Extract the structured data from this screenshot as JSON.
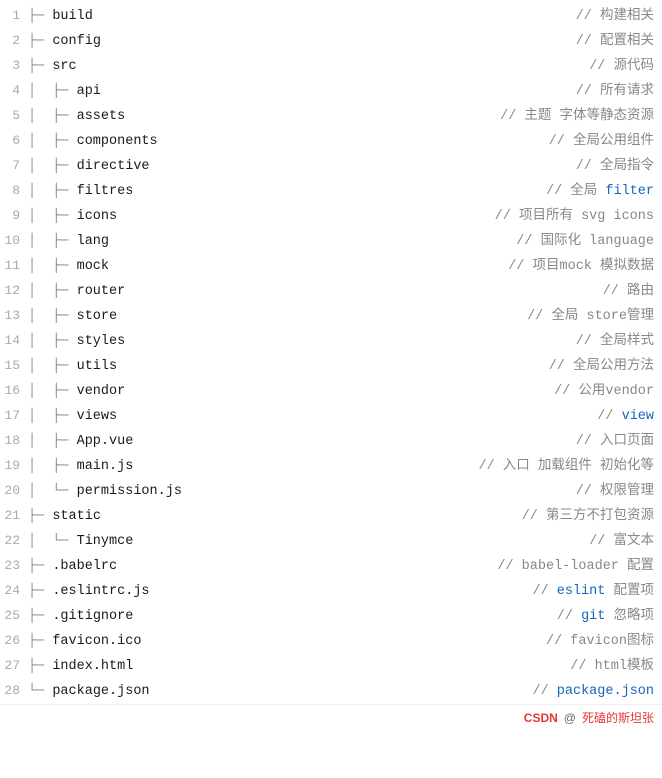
{
  "lines": [
    {
      "num": 1,
      "indent": "├─ ",
      "level": 0,
      "name": "build",
      "comment": "// 构建相关",
      "commentHighlight": null
    },
    {
      "num": 2,
      "indent": "├─ ",
      "level": 0,
      "name": "config",
      "comment": "// 配置相关",
      "commentHighlight": null
    },
    {
      "num": 3,
      "indent": "├─ ",
      "level": 0,
      "name": "src",
      "comment": "// 源代码",
      "commentHighlight": null
    },
    {
      "num": 4,
      "indent": "│  ├─ ",
      "level": 1,
      "name": "api",
      "comment": "// 所有请求",
      "commentHighlight": null
    },
    {
      "num": 5,
      "indent": "│  ├─ ",
      "level": 1,
      "name": "assets",
      "comment": "// 主题 字体等静态资源",
      "commentHighlight": null
    },
    {
      "num": 6,
      "indent": "│  ├─ ",
      "level": 1,
      "name": "components",
      "comment": "// 全局公用组件",
      "commentHighlight": null
    },
    {
      "num": 7,
      "indent": "│  ├─ ",
      "level": 1,
      "name": "directive",
      "comment": "// 全局指令",
      "commentHighlight": null
    },
    {
      "num": 8,
      "indent": "│  ├─ ",
      "level": 1,
      "name": "filtres",
      "comment": "// 全局 filter",
      "commentHighlight": "filter"
    },
    {
      "num": 9,
      "indent": "│  ├─ ",
      "level": 1,
      "name": "icons",
      "comment": "// 项目所有 svg icons",
      "commentHighlight": null
    },
    {
      "num": 10,
      "indent": "│  ├─ ",
      "level": 1,
      "name": "lang",
      "comment": "// 国际化 language",
      "commentHighlight": null
    },
    {
      "num": 11,
      "indent": "│  ├─ ",
      "level": 1,
      "name": "mock",
      "comment": "// 项目mock 模拟数据",
      "commentHighlight": null
    },
    {
      "num": 12,
      "indent": "│  ├─ ",
      "level": 1,
      "name": "router",
      "comment": "// 路由",
      "commentHighlight": null
    },
    {
      "num": 13,
      "indent": "│  ├─ ",
      "level": 1,
      "name": "store",
      "comment": "// 全局 store管理",
      "commentHighlight": null
    },
    {
      "num": 14,
      "indent": "│  ├─ ",
      "level": 1,
      "name": "styles",
      "comment": "// 全局样式",
      "commentHighlight": null
    },
    {
      "num": 15,
      "indent": "│  ├─ ",
      "level": 1,
      "name": "utils",
      "comment": "// 全局公用方法",
      "commentHighlight": null
    },
    {
      "num": 16,
      "indent": "│  ├─ ",
      "level": 1,
      "name": "vendor",
      "comment": "// 公用vendor",
      "commentHighlight": null
    },
    {
      "num": 17,
      "indent": "│  ├─ ",
      "level": 1,
      "name": "views",
      "comment": " // view",
      "commentHighlight": "view"
    },
    {
      "num": 18,
      "indent": "│  ├─ ",
      "level": 1,
      "name": "App.vue",
      "comment": "// 入口页面",
      "commentHighlight": null
    },
    {
      "num": 19,
      "indent": "│  ├─ ",
      "level": 1,
      "name": "main.js",
      "comment": "// 入口 加载组件 初始化等",
      "commentHighlight": null
    },
    {
      "num": 20,
      "indent": "│  └─ ",
      "level": 1,
      "name": "permission.js",
      "comment": "// 权限管理",
      "commentHighlight": null
    },
    {
      "num": 21,
      "indent": "├─ ",
      "level": 0,
      "name": "static",
      "comment": "// 第三方不打包资源",
      "commentHighlight": null
    },
    {
      "num": 22,
      "indent": "│  └─ ",
      "level": 1,
      "name": "Tinymce",
      "comment": "// 富文本",
      "commentHighlight": null
    },
    {
      "num": 23,
      "indent": "├─ ",
      "level": 0,
      "name": ".babelrc",
      "comment": "// babel-loader 配置",
      "commentHighlight": null
    },
    {
      "num": 24,
      "indent": "├─ ",
      "level": 0,
      "name": ".eslintrc.js",
      "comment": " // eslint 配置项",
      "commentHighlight": "eslint"
    },
    {
      "num": 25,
      "indent": "├─ ",
      "level": 0,
      "name": ".gitignore",
      "comment": "// git 忽略项",
      "commentHighlight": "git"
    },
    {
      "num": 26,
      "indent": "├─ ",
      "level": 0,
      "name": "favicon.ico",
      "comment": "// favicon图标",
      "commentHighlight": null
    },
    {
      "num": 27,
      "indent": "├─ ",
      "level": 0,
      "name": "index.html",
      "comment": "// html模板",
      "commentHighlight": null
    },
    {
      "num": 28,
      "indent": "└─ ",
      "level": 0,
      "name": "package.json",
      "comment": "// package.json",
      "commentHighlight": "package.json"
    }
  ],
  "footer": {
    "brand": "CSDN",
    "at": "@",
    "user": "死磕的斯坦张"
  }
}
